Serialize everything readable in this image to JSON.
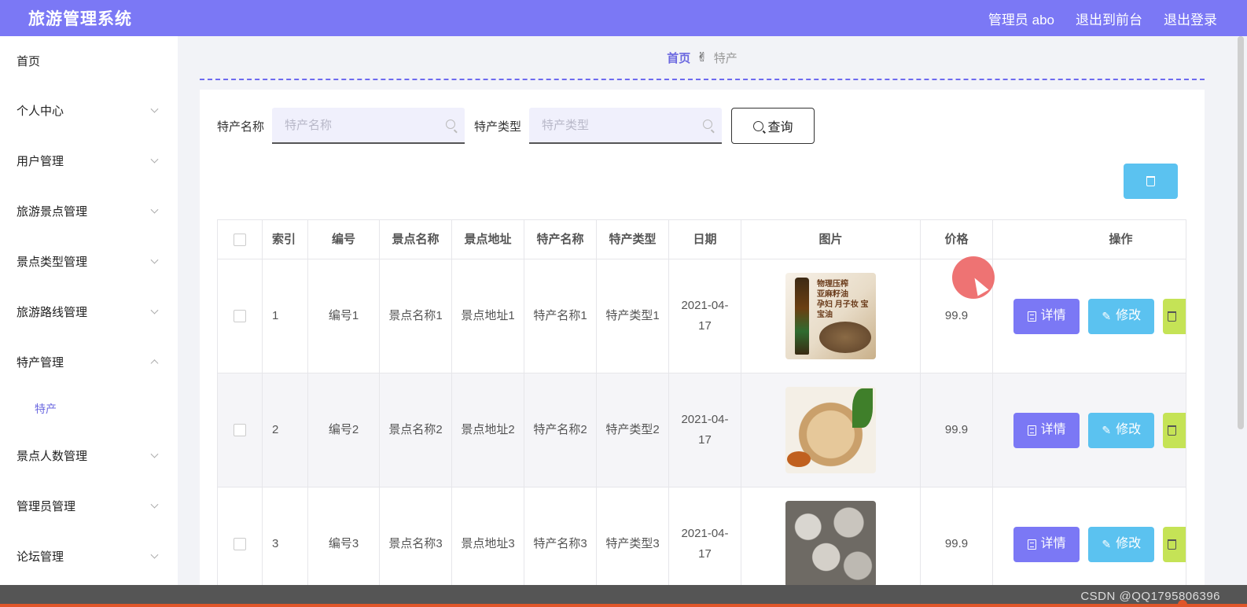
{
  "header": {
    "brand": "旅游管理系统",
    "links": [
      "管理员 abo",
      "退出到前台",
      "退出登录"
    ]
  },
  "sidebar": {
    "home": "首页",
    "items": [
      {
        "label": "个人中心",
        "expanded": false
      },
      {
        "label": "用户管理",
        "expanded": false
      },
      {
        "label": "旅游景点管理",
        "expanded": false
      },
      {
        "label": "景点类型管理",
        "expanded": false
      },
      {
        "label": "旅游路线管理",
        "expanded": false
      },
      {
        "label": "特产管理",
        "expanded": true
      },
      {
        "label": "景点人数管理",
        "expanded": false
      },
      {
        "label": "管理员管理",
        "expanded": false
      },
      {
        "label": "论坛管理",
        "expanded": false
      }
    ],
    "active_sub": "特产"
  },
  "breadcrumb": {
    "home": "首页",
    "separator": "✌",
    "current": "特产"
  },
  "search": {
    "name_label": "特产名称",
    "name_placeholder": "特产名称",
    "type_label": "特产类型",
    "type_placeholder": "特产类型",
    "query_label": "查询"
  },
  "table": {
    "headers": [
      "索引",
      "编号",
      "景点名称",
      "景点地址",
      "特产名称",
      "特产类型",
      "日期",
      "图片",
      "价格",
      "操作"
    ],
    "rows": [
      {
        "index": "1",
        "number": "编号1",
        "spot_name": "景点名称1",
        "spot_address": "景点地址1",
        "product_name": "特产名称1",
        "product_type": "特产类型1",
        "date": "2021-04-17",
        "price": "99.9",
        "image_text": [
          "物理压榨",
          "亚麻籽油",
          "孕妇 月子妆 宝宝油"
        ]
      },
      {
        "index": "2",
        "number": "编号2",
        "spot_name": "景点名称2",
        "spot_address": "景点地址2",
        "product_name": "特产名称2",
        "product_type": "特产类型2",
        "date": "2021-04-17",
        "price": "99.9"
      },
      {
        "index": "3",
        "number": "编号3",
        "spot_name": "景点名称3",
        "spot_address": "景点地址3",
        "product_name": "特产名称3",
        "product_type": "特产类型3",
        "date": "2021-04-17",
        "price": "99.9"
      }
    ],
    "actions": {
      "detail": "详情",
      "edit": "修改"
    }
  },
  "watermark": "CSDN @QQ1795806396",
  "colors": {
    "primary": "#7b78f5",
    "info": "#5bc2f0",
    "success": "#c5e356"
  }
}
